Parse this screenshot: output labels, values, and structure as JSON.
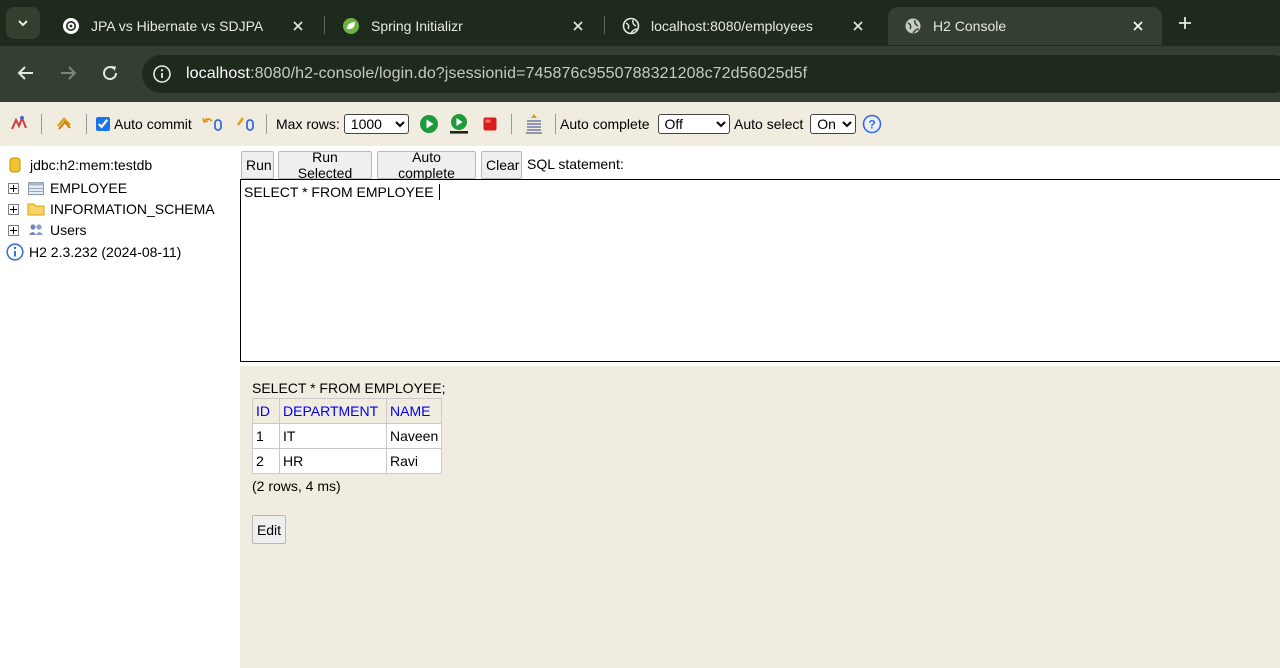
{
  "browser": {
    "tabs": [
      {
        "title": "JPA vs Hibernate vs SDJPA",
        "icon": "openai-icon",
        "active": false
      },
      {
        "title": "Spring Initializr",
        "icon": "spring-leaf-icon",
        "active": false
      },
      {
        "title": "localhost:8080/employees",
        "icon": "globe-icon",
        "active": false
      },
      {
        "title": "H2 Console",
        "icon": "globe-icon",
        "active": true
      }
    ],
    "address": {
      "host": "localhost",
      "rest": ":8080/h2-console/login.do?jsessionid=745876c9550788321208c72d56025d5f"
    }
  },
  "h2_toolbar": {
    "auto_commit_label": "Auto commit",
    "auto_commit_checked": true,
    "max_rows_label": "Max rows:",
    "max_rows_value": "1000",
    "auto_complete_label": "Auto complete",
    "auto_complete_value": "Off",
    "auto_select_label": "Auto select",
    "auto_select_value": "On"
  },
  "tree": {
    "connection": "jdbc:h2:mem:testdb",
    "items": [
      {
        "label": "EMPLOYEE",
        "icon": "table-icon"
      },
      {
        "label": "INFORMATION_SCHEMA",
        "icon": "folder-icon"
      },
      {
        "label": "Users",
        "icon": "users-icon"
      }
    ],
    "version": "H2 2.3.232 (2024-08-11)"
  },
  "query": {
    "run_label": "Run",
    "run_selected_label": "Run Selected",
    "auto_complete_label": "Auto complete",
    "clear_label": "Clear",
    "sql_statement_label": "SQL statement:",
    "sql_text": "SELECT * FROM EMPLOYEE "
  },
  "result": {
    "statement": "SELECT * FROM EMPLOYEE;",
    "columns": [
      "ID",
      "DEPARTMENT",
      "NAME"
    ],
    "rows": [
      [
        "1",
        "IT",
        "Naveen"
      ],
      [
        "2",
        "HR",
        "Ravi"
      ]
    ],
    "summary": "(2 rows, 4 ms)",
    "edit_label": "Edit"
  },
  "colors": {
    "tabstrip_bg": "#1d2a1c",
    "toolbar_bg": "#333f30",
    "h2_panel_bg": "#f0ede0",
    "header_link": "#0000ee"
  }
}
